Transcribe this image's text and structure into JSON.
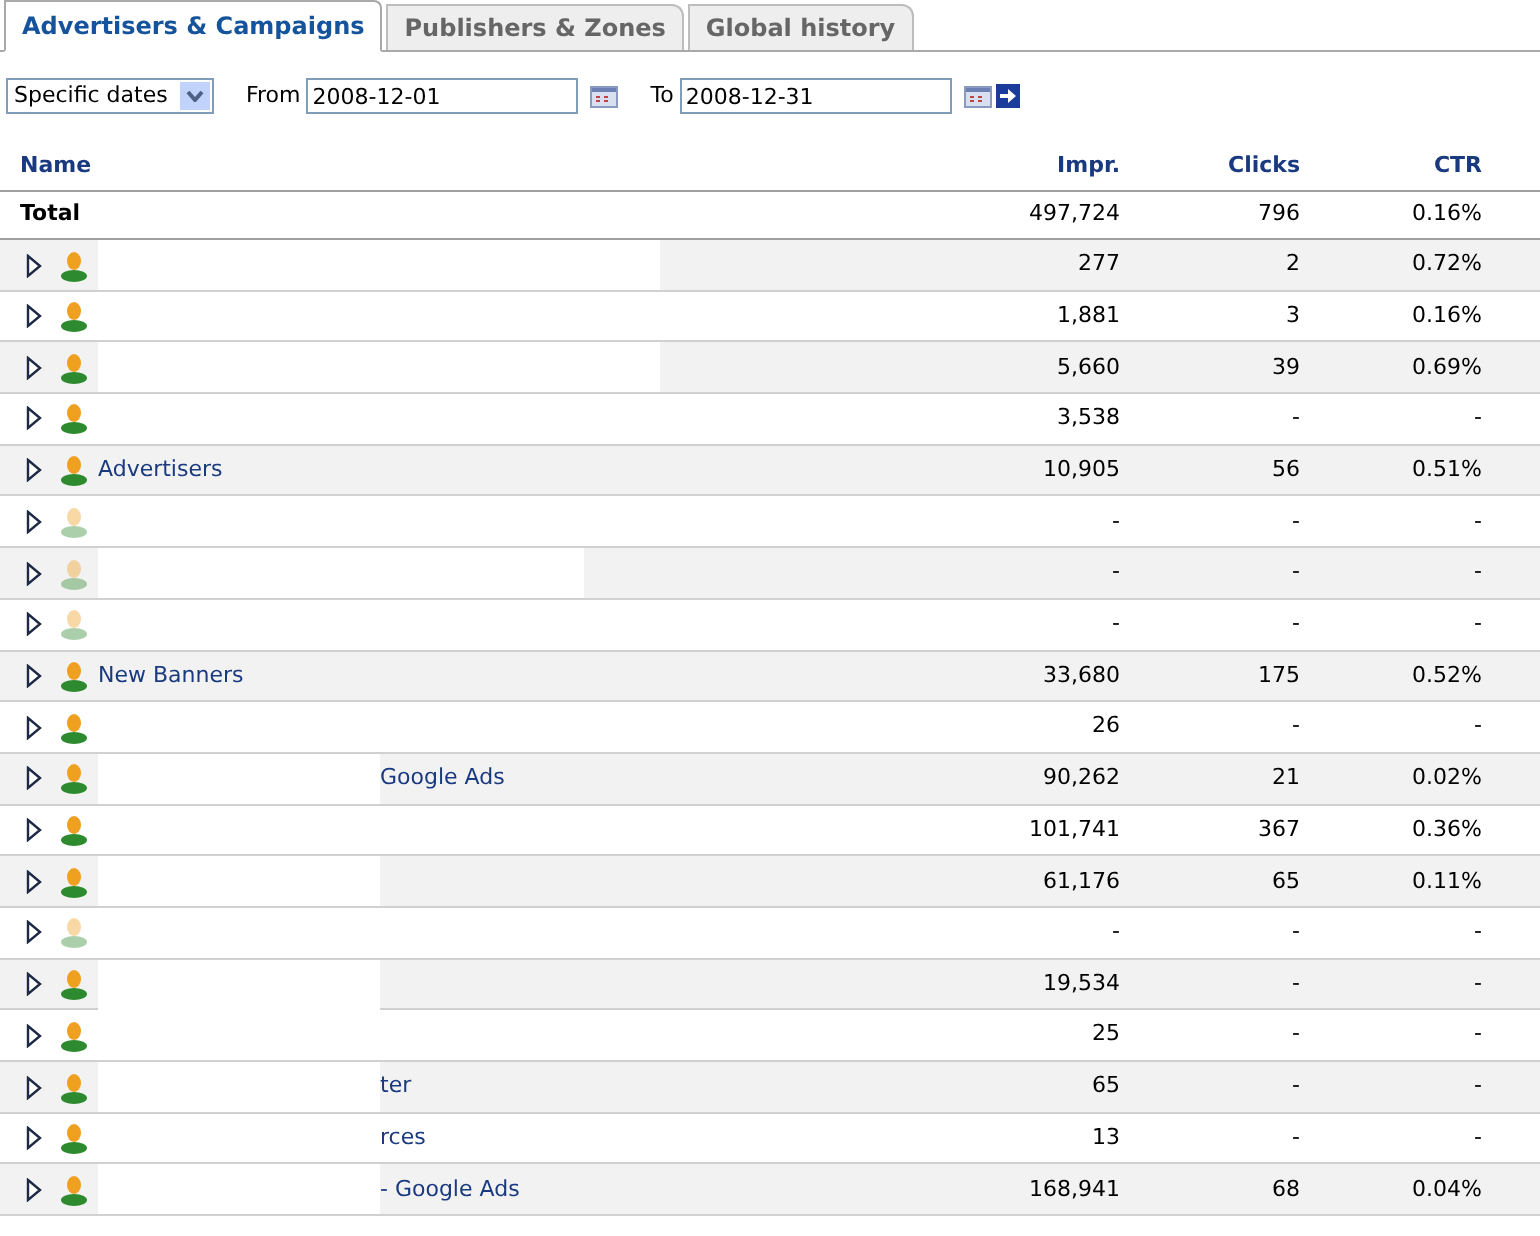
{
  "tabs": [
    {
      "label": "Advertisers & Campaigns",
      "selected": true
    },
    {
      "label": "Publishers & Zones",
      "selected": false
    },
    {
      "label": "Global history",
      "selected": false
    }
  ],
  "filter": {
    "period": "Specific dates",
    "from_label": "From",
    "from": "2008-12-01",
    "to_label": "To",
    "to": "2008-12-31"
  },
  "table": {
    "columns": [
      "Name",
      "Impr.",
      "Clicks",
      "CTR"
    ],
    "total": {
      "name": "Total",
      "impressions": "497,724",
      "clicks": "796",
      "ctr": "0.16%"
    },
    "rows": [
      {
        "name": "",
        "active": true,
        "kind": "wide",
        "impressions": "277",
        "clicks": "2",
        "ctr": "0.72%"
      },
      {
        "name": "",
        "active": true,
        "kind": "wide",
        "impressions": "1,881",
        "clicks": "3",
        "ctr": "0.16%"
      },
      {
        "name": "",
        "active": true,
        "kind": "wide",
        "impressions": "5,660",
        "clicks": "39",
        "ctr": "0.69%"
      },
      {
        "name": "",
        "active": true,
        "kind": "wide",
        "impressions": "3,538",
        "clicks": "-",
        "ctr": "-"
      },
      {
        "name": "Advertisers",
        "active": true,
        "kind": "name",
        "impressions": "10,905",
        "clicks": "56",
        "ctr": "0.51%"
      },
      {
        "name": "",
        "active": false,
        "kind": "medium",
        "impressions": "-",
        "clicks": "-",
        "ctr": "-"
      },
      {
        "name": "",
        "active": false,
        "kind": "medium",
        "impressions": "-",
        "clicks": "-",
        "ctr": "-"
      },
      {
        "name": "",
        "active": false,
        "kind": "medium",
        "impressions": "-",
        "clicks": "-",
        "ctr": "-"
      },
      {
        "name": "New Banners",
        "active": true,
        "kind": "name",
        "impressions": "33,680",
        "clicks": "175",
        "ctr": "0.52%"
      },
      {
        "name": "",
        "active": true,
        "kind": "narrow",
        "impressions": "26",
        "clicks": "-",
        "ctr": "-"
      },
      {
        "name": "Google Ads",
        "active": true,
        "kind": "narrow",
        "impressions": "90,262",
        "clicks": "21",
        "ctr": "0.02%"
      },
      {
        "name": "",
        "active": true,
        "kind": "narrow",
        "impressions": "101,741",
        "clicks": "367",
        "ctr": "0.36%"
      },
      {
        "name": "",
        "active": true,
        "kind": "narrow",
        "impressions": "61,176",
        "clicks": "65",
        "ctr": "0.11%"
      },
      {
        "name": "",
        "active": false,
        "kind": "narrow",
        "impressions": "-",
        "clicks": "-",
        "ctr": "-"
      },
      {
        "name": "",
        "active": true,
        "kind": "narrow",
        "impressions": "19,534",
        "clicks": "-",
        "ctr": "-"
      },
      {
        "name": "",
        "active": true,
        "kind": "narrow",
        "impressions": "25",
        "clicks": "-",
        "ctr": "-"
      },
      {
        "name": "ter",
        "active": true,
        "kind": "narrow",
        "impressions": "65",
        "clicks": "-",
        "ctr": "-"
      },
      {
        "name": "rces",
        "active": true,
        "kind": "narrow",
        "impressions": "13",
        "clicks": "-",
        "ctr": "-"
      },
      {
        "name": "- Google Ads",
        "active": true,
        "kind": "narrow",
        "impressions": "168,941",
        "clicks": "68",
        "ctr": "0.04%"
      }
    ]
  }
}
